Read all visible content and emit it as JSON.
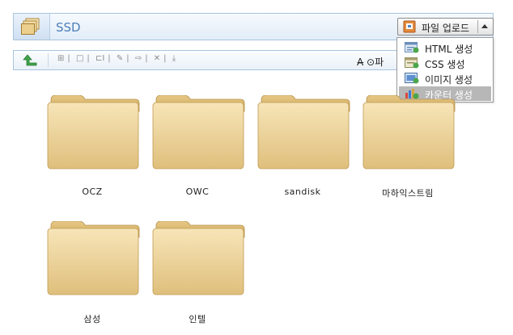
{
  "header": {
    "title": "SSD",
    "upload_label": "파일 업로드"
  },
  "toolbar": {
    "right_text": "A̶ ⊙파"
  },
  "dropdown": {
    "items": [
      {
        "label": "HTML 생성",
        "icon": "html-file-icon"
      },
      {
        "label": "CSS  생성",
        "icon": "css-file-icon"
      },
      {
        "label": "이미지 생성",
        "icon": "image-file-icon"
      },
      {
        "label": "카운터 생성",
        "icon": "counter-chart-icon",
        "active": true
      }
    ]
  },
  "folders": [
    {
      "name": "OCZ"
    },
    {
      "name": "OWC"
    },
    {
      "name": "sandisk"
    },
    {
      "name": "마하익스트림"
    },
    {
      "name": "삼성"
    },
    {
      "name": "인텔"
    }
  ]
}
